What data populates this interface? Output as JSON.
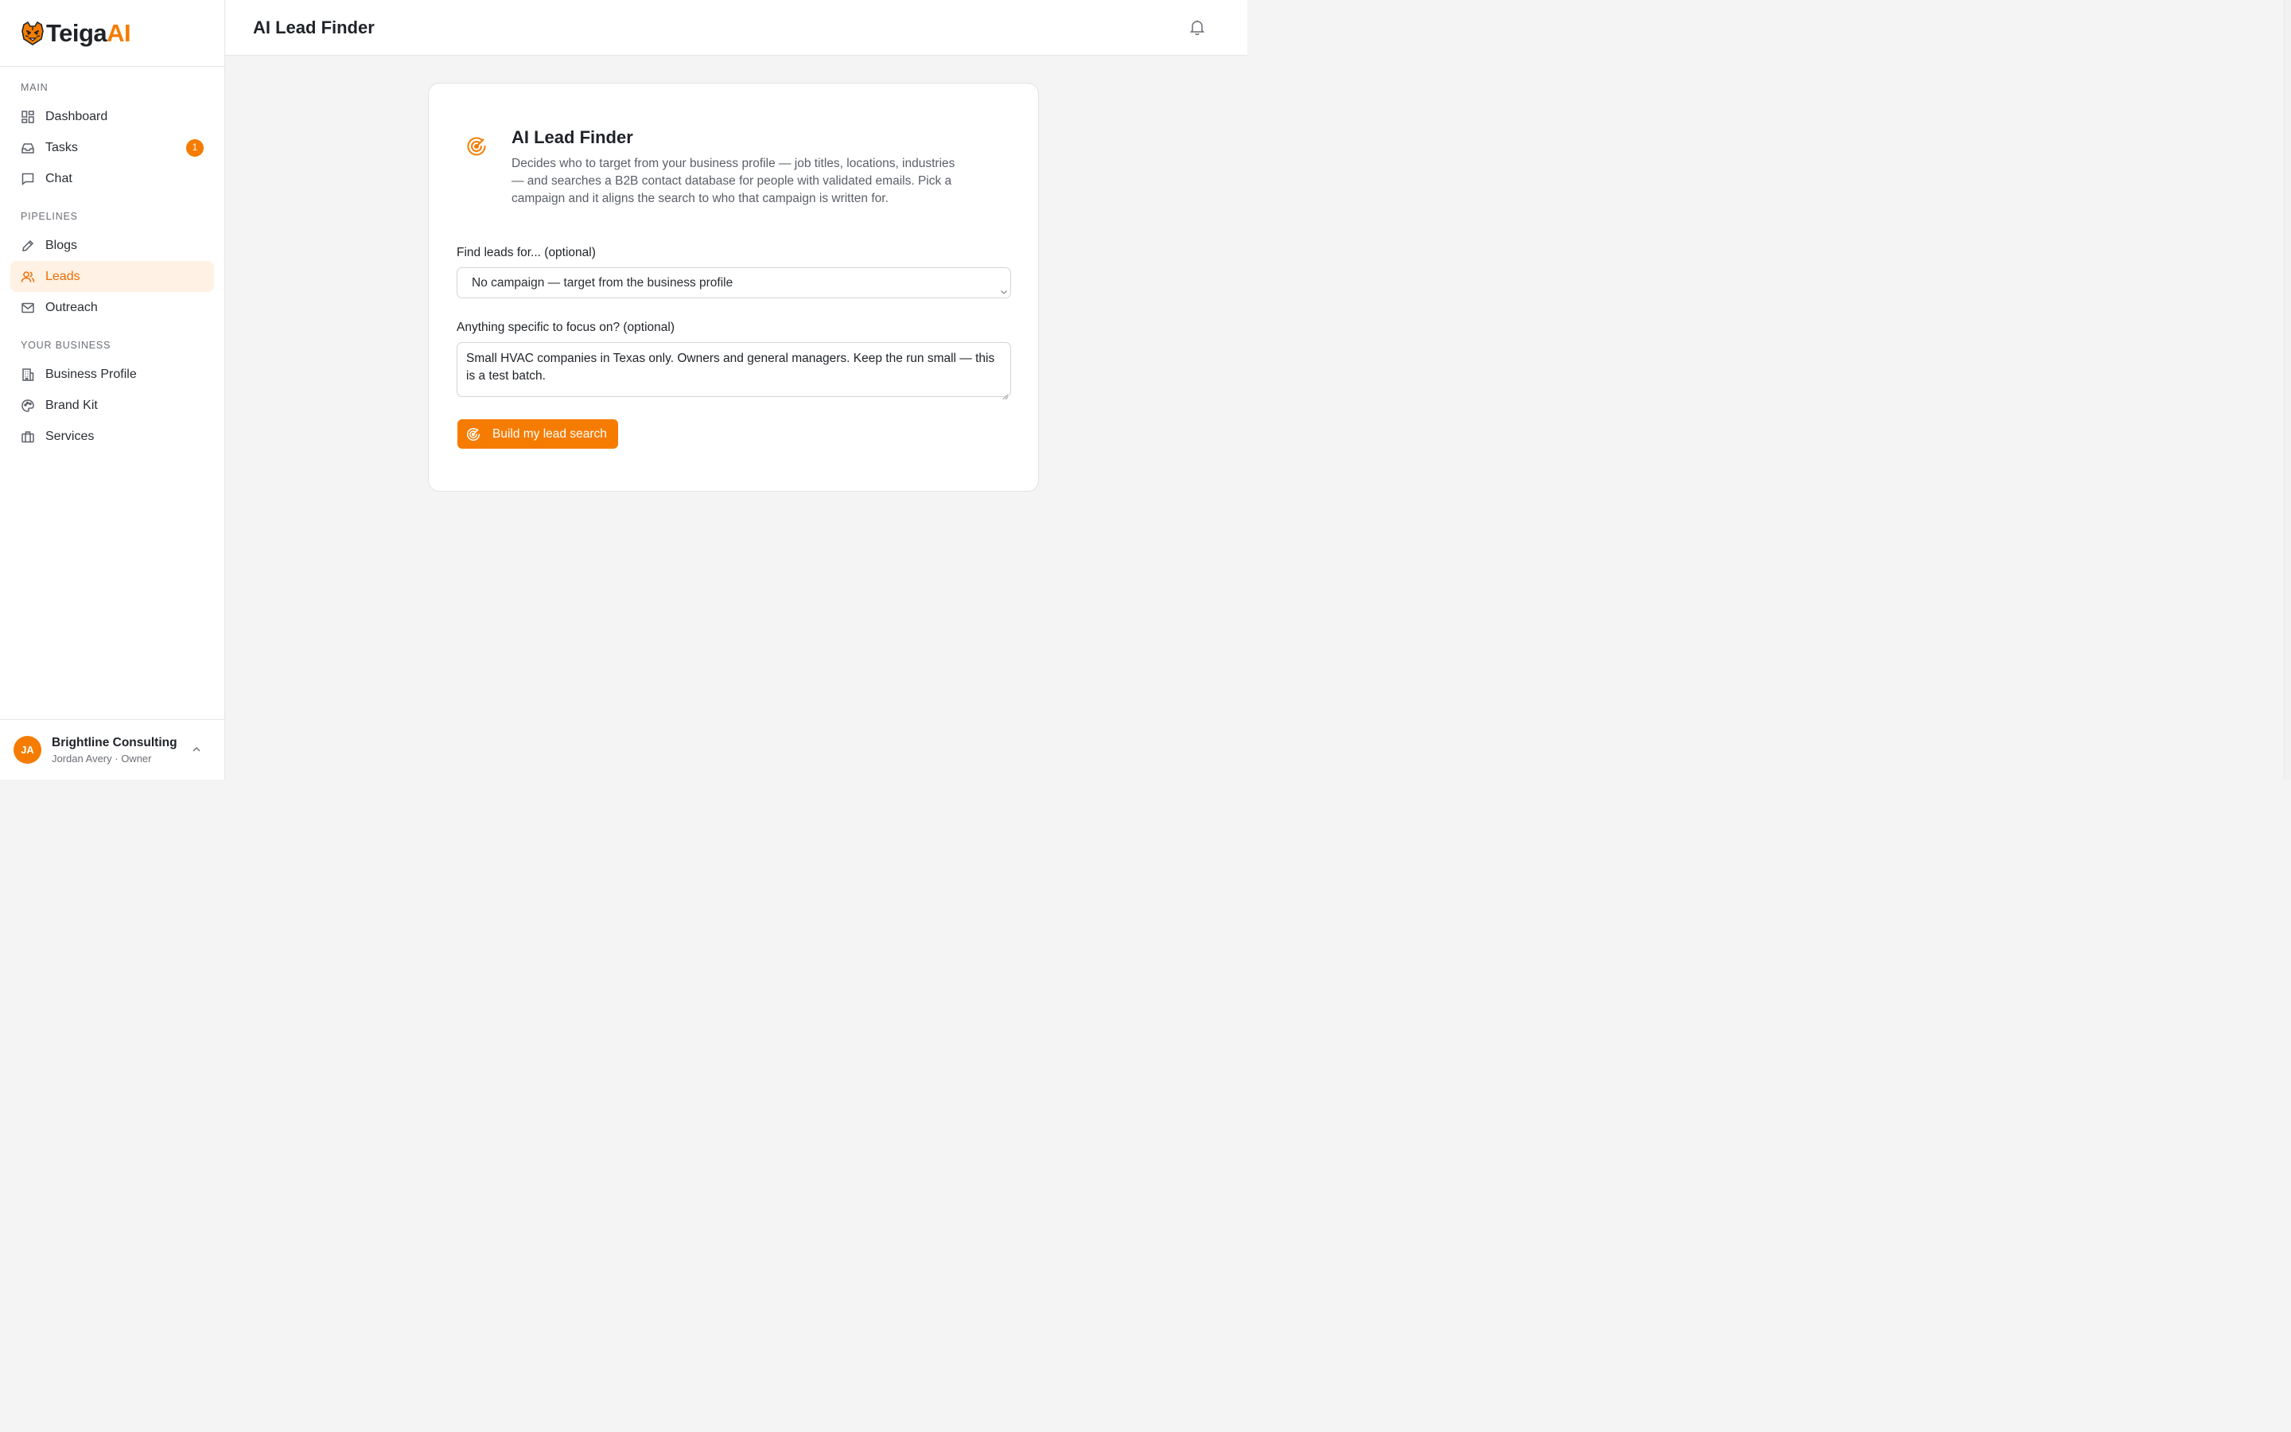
{
  "brand": {
    "name_main": "Teiga",
    "name_accent": "AI"
  },
  "sidebar": {
    "sections": {
      "main": "MAIN",
      "pipelines": "PIPELINES",
      "your_business": "YOUR BUSINESS"
    },
    "items": [
      {
        "label": "Dashboard",
        "icon": "grid-icon"
      },
      {
        "label": "Tasks",
        "icon": "inbox-icon",
        "badge": "1"
      },
      {
        "label": "Chat",
        "icon": "chat-icon"
      },
      {
        "label": "Blogs",
        "icon": "pencil-icon"
      },
      {
        "label": "Leads",
        "icon": "users-icon",
        "active": true
      },
      {
        "label": "Outreach",
        "icon": "mail-icon"
      },
      {
        "label": "Business Profile",
        "icon": "building-icon"
      },
      {
        "label": "Brand Kit",
        "icon": "palette-icon"
      },
      {
        "label": "Services",
        "icon": "briefcase-icon"
      }
    ]
  },
  "account": {
    "initials": "JA",
    "name": "Brightline Consulting",
    "subtitle": "Jordan Avery · Owner"
  },
  "header": {
    "title": "AI Lead Finder"
  },
  "card": {
    "title": "AI Lead Finder",
    "description": "Decides who to target from your business profile — job titles, locations, industries — and searches a B2B contact database for people with validated emails. Pick a campaign and it aligns the search to who that campaign is written for.",
    "campaign_label": "Find leads for... (optional)",
    "campaign_value": "No campaign — target from the business profile",
    "focus_label": "Anything specific to focus on? (optional)",
    "focus_value": "Small HVAC companies in Texas only. Owners and general managers. Keep the run small — this is a test batch.",
    "button_label": "Build my lead search"
  },
  "colors": {
    "accent": "#f57c00",
    "active_bg": "#fff1e4"
  }
}
